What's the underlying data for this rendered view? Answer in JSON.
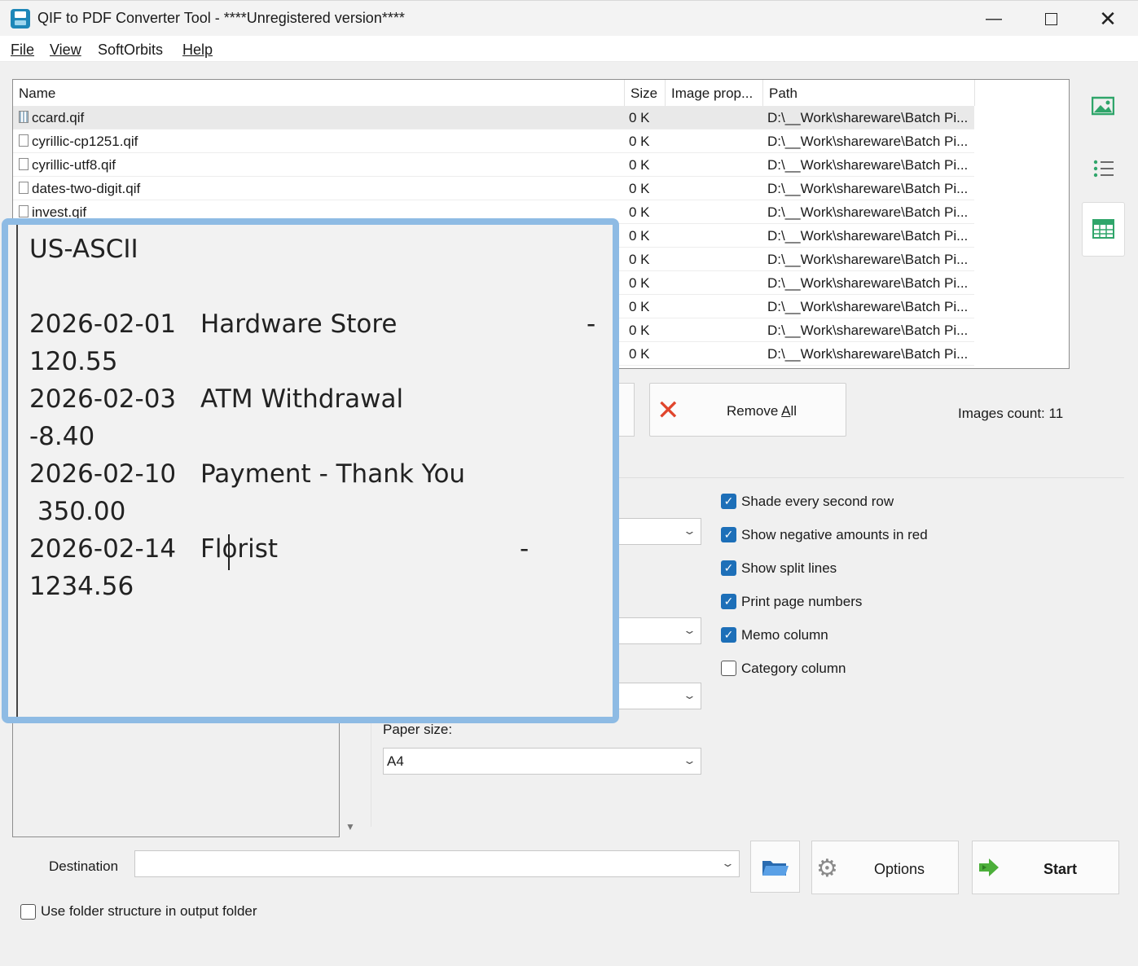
{
  "window": {
    "title": "QIF to PDF Converter Tool - ****Unregistered version****"
  },
  "menu": {
    "file": "File",
    "view": "View",
    "softorbits": "SoftOrbits",
    "help": "Help"
  },
  "table": {
    "headers": [
      "Name",
      "Size",
      "Image prop...",
      "Path"
    ],
    "rows": [
      {
        "name": "ccard.qif",
        "size": "0 K",
        "path": "D:\\__Work\\shareware\\Batch Pi..."
      },
      {
        "name": "cyrillic-cp1251.qif",
        "size": "0 K",
        "path": "D:\\__Work\\shareware\\Batch Pi..."
      },
      {
        "name": "cyrillic-utf8.qif",
        "size": "0 K",
        "path": "D:\\__Work\\shareware\\Batch Pi..."
      },
      {
        "name": "dates-two-digit.qif",
        "size": "0 K",
        "path": "D:\\__Work\\shareware\\Batch Pi..."
      },
      {
        "name": "invest.qif",
        "size": "0 K",
        "path": "D:\\__Work\\shareware\\Batch Pi..."
      },
      {
        "name": "",
        "size": "0 K",
        "path": "D:\\__Work\\shareware\\Batch Pi..."
      },
      {
        "name": "",
        "size": "0 K",
        "path": "D:\\__Work\\shareware\\Batch Pi..."
      },
      {
        "name": "",
        "size": "0 K",
        "path": "D:\\__Work\\shareware\\Batch Pi..."
      },
      {
        "name": "",
        "size": "0 K",
        "path": "D:\\__Work\\shareware\\Batch Pi..."
      },
      {
        "name": "",
        "size": "0 K",
        "path": "D:\\__Work\\shareware\\Batch Pi..."
      },
      {
        "name": "",
        "size": "0 K",
        "path": "D:\\__Work\\shareware\\Batch Pi..."
      }
    ]
  },
  "actions": {
    "remove_all_prefix": "Remove ",
    "remove_all_accel": "A",
    "remove_all_suffix": "ll",
    "images_count": "Images count: 11"
  },
  "options": {
    "shade_rows": "Shade every second row",
    "negative_red": "Show negative amounts in red",
    "split_lines": "Show split lines",
    "page_numbers": "Print page numbers",
    "memo_column": "Memo column",
    "category_column": "Category column",
    "paper_size_label": "Paper size:",
    "paper_size_value": "A4"
  },
  "bottom": {
    "destination_label": "Destination",
    "destination_value": "",
    "options_label": "Options",
    "start_label": "Start",
    "folder_structure_label": "Use folder structure in output folder"
  },
  "preview": {
    "encoding": "US-ASCII",
    "lines": [
      {
        "date": "2026-02-01",
        "payee": "Hardware Store",
        "sign": "-",
        "amount": "120.55"
      },
      {
        "date": "2026-02-03",
        "payee": "ATM Withdrawal",
        "sign": "",
        "amount": "-8.40"
      },
      {
        "date": "2026-02-10",
        "payee": "Payment - Thank You",
        "sign": "",
        "amount": " 350.00"
      },
      {
        "date": "2026-02-14",
        "payee": "Florist",
        "sign": "-",
        "amount": "1234.56"
      }
    ]
  },
  "colors": {
    "accent": "#1d6fb8",
    "preview_border": "#8ebbe4",
    "remove_icon": "#e0452c",
    "start_icon": "#4caf3a",
    "image_icon": "#2fa56a"
  }
}
